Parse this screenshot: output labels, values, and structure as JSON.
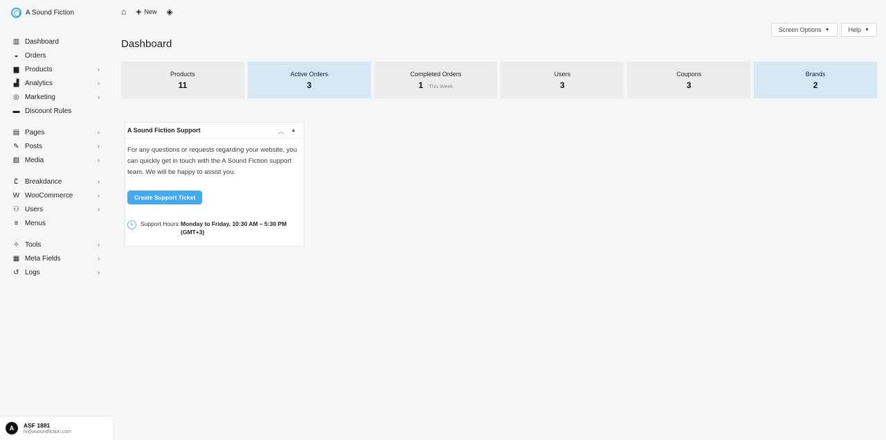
{
  "brand": {
    "name": "A Sound Fiction"
  },
  "sidebar": {
    "groups": [
      [
        {
          "label": "Dashboard",
          "icon": "dashboard-icon",
          "glyph": "▥",
          "chevron": false
        },
        {
          "label": "Orders",
          "icon": "orders-icon",
          "glyph": "◒",
          "chevron": false
        },
        {
          "label": "Products",
          "icon": "products-icon",
          "glyph": "▆",
          "chevron": true
        },
        {
          "label": "Analytics",
          "icon": "analytics-icon",
          "glyph": "▟",
          "chevron": true
        },
        {
          "label": "Marketing",
          "icon": "marketing-icon",
          "glyph": "◎",
          "chevron": true
        },
        {
          "label": "Discount Rules",
          "icon": "discount-icon",
          "glyph": "▬",
          "chevron": false
        }
      ],
      [
        {
          "label": "Pages",
          "icon": "pages-icon",
          "glyph": "▤",
          "chevron": true
        },
        {
          "label": "Posts",
          "icon": "posts-icon",
          "glyph": "✎",
          "chevron": true
        },
        {
          "label": "Media",
          "icon": "media-icon",
          "glyph": "▨",
          "chevron": true
        }
      ],
      [
        {
          "label": "Breakdance",
          "icon": "breakdance-icon",
          "glyph": "Ꮭ",
          "chevron": true
        },
        {
          "label": "WooCommerce",
          "icon": "woocommerce-icon",
          "glyph": "W",
          "chevron": true
        },
        {
          "label": "Users",
          "icon": "users-icon",
          "glyph": "⚇",
          "chevron": true
        },
        {
          "label": "Menus",
          "icon": "menus-icon",
          "glyph": "≡",
          "chevron": false
        }
      ],
      [
        {
          "label": "Tools",
          "icon": "tools-icon",
          "glyph": "✧",
          "chevron": true
        },
        {
          "label": "Meta Fields",
          "icon": "meta-fields-icon",
          "glyph": "▦",
          "chevron": true
        },
        {
          "label": "Logs",
          "icon": "logs-icon",
          "glyph": "↺",
          "chevron": true
        }
      ]
    ]
  },
  "user": {
    "initial": "A",
    "name": "ASF 1881",
    "email": "hi@asoundfiction.com"
  },
  "topbar": {
    "new_label": "New"
  },
  "screen_options": {
    "screen_label": "Screen Options",
    "help_label": "Help"
  },
  "page": {
    "title": "Dashboard"
  },
  "stats": [
    {
      "label": "Products",
      "value": "11",
      "sub": "",
      "highlight": false
    },
    {
      "label": "Active Orders",
      "value": "3",
      "sub": "",
      "highlight": true
    },
    {
      "label": "Completed Orders",
      "value": "1",
      "sub": "This Week",
      "highlight": false
    },
    {
      "label": "Users",
      "value": "3",
      "sub": "",
      "highlight": false
    },
    {
      "label": "Coupons",
      "value": "3",
      "sub": "",
      "highlight": false
    },
    {
      "label": "Brands",
      "value": "2",
      "sub": "",
      "highlight": true
    }
  ],
  "support_widget": {
    "title": "A Sound Fiction Support",
    "text": "For any questions or requests regarding your website, you can quickly get in touch with the A Sound Fiction support team. We will be happy to assist you.",
    "button_label": "Create Support Ticket",
    "hours_label": "Support Hours:",
    "hours_value": "Monday to Friday, 10:30 AM – 5:30 PM (GMT+3)"
  },
  "colors": {
    "accent": "#41aaf0",
    "highlight_card": "#d6e7f4",
    "card": "#ececec"
  }
}
